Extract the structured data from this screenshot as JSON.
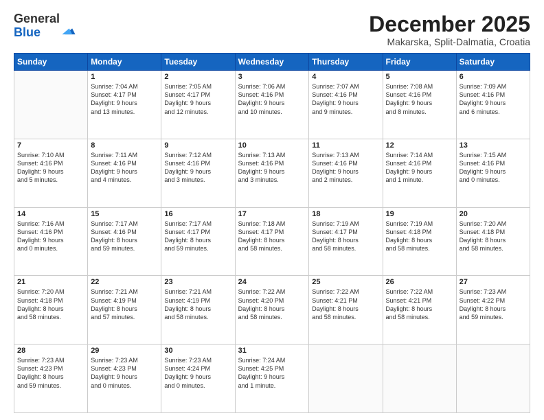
{
  "header": {
    "logo_general": "General",
    "logo_blue": "Blue",
    "month_title": "December 2025",
    "location": "Makarska, Split-Dalmatia, Croatia"
  },
  "days_of_week": [
    "Sunday",
    "Monday",
    "Tuesday",
    "Wednesday",
    "Thursday",
    "Friday",
    "Saturday"
  ],
  "weeks": [
    [
      {
        "day": "",
        "info": ""
      },
      {
        "day": "1",
        "info": "Sunrise: 7:04 AM\nSunset: 4:17 PM\nDaylight: 9 hours\nand 13 minutes."
      },
      {
        "day": "2",
        "info": "Sunrise: 7:05 AM\nSunset: 4:17 PM\nDaylight: 9 hours\nand 12 minutes."
      },
      {
        "day": "3",
        "info": "Sunrise: 7:06 AM\nSunset: 4:16 PM\nDaylight: 9 hours\nand 10 minutes."
      },
      {
        "day": "4",
        "info": "Sunrise: 7:07 AM\nSunset: 4:16 PM\nDaylight: 9 hours\nand 9 minutes."
      },
      {
        "day": "5",
        "info": "Sunrise: 7:08 AM\nSunset: 4:16 PM\nDaylight: 9 hours\nand 8 minutes."
      },
      {
        "day": "6",
        "info": "Sunrise: 7:09 AM\nSunset: 4:16 PM\nDaylight: 9 hours\nand 6 minutes."
      }
    ],
    [
      {
        "day": "7",
        "info": "Sunrise: 7:10 AM\nSunset: 4:16 PM\nDaylight: 9 hours\nand 5 minutes."
      },
      {
        "day": "8",
        "info": "Sunrise: 7:11 AM\nSunset: 4:16 PM\nDaylight: 9 hours\nand 4 minutes."
      },
      {
        "day": "9",
        "info": "Sunrise: 7:12 AM\nSunset: 4:16 PM\nDaylight: 9 hours\nand 3 minutes."
      },
      {
        "day": "10",
        "info": "Sunrise: 7:13 AM\nSunset: 4:16 PM\nDaylight: 9 hours\nand 3 minutes."
      },
      {
        "day": "11",
        "info": "Sunrise: 7:13 AM\nSunset: 4:16 PM\nDaylight: 9 hours\nand 2 minutes."
      },
      {
        "day": "12",
        "info": "Sunrise: 7:14 AM\nSunset: 4:16 PM\nDaylight: 9 hours\nand 1 minute."
      },
      {
        "day": "13",
        "info": "Sunrise: 7:15 AM\nSunset: 4:16 PM\nDaylight: 9 hours\nand 0 minutes."
      }
    ],
    [
      {
        "day": "14",
        "info": "Sunrise: 7:16 AM\nSunset: 4:16 PM\nDaylight: 9 hours\nand 0 minutes."
      },
      {
        "day": "15",
        "info": "Sunrise: 7:17 AM\nSunset: 4:16 PM\nDaylight: 8 hours\nand 59 minutes."
      },
      {
        "day": "16",
        "info": "Sunrise: 7:17 AM\nSunset: 4:17 PM\nDaylight: 8 hours\nand 59 minutes."
      },
      {
        "day": "17",
        "info": "Sunrise: 7:18 AM\nSunset: 4:17 PM\nDaylight: 8 hours\nand 58 minutes."
      },
      {
        "day": "18",
        "info": "Sunrise: 7:19 AM\nSunset: 4:17 PM\nDaylight: 8 hours\nand 58 minutes."
      },
      {
        "day": "19",
        "info": "Sunrise: 7:19 AM\nSunset: 4:18 PM\nDaylight: 8 hours\nand 58 minutes."
      },
      {
        "day": "20",
        "info": "Sunrise: 7:20 AM\nSunset: 4:18 PM\nDaylight: 8 hours\nand 58 minutes."
      }
    ],
    [
      {
        "day": "21",
        "info": "Sunrise: 7:20 AM\nSunset: 4:18 PM\nDaylight: 8 hours\nand 58 minutes."
      },
      {
        "day": "22",
        "info": "Sunrise: 7:21 AM\nSunset: 4:19 PM\nDaylight: 8 hours\nand 57 minutes."
      },
      {
        "day": "23",
        "info": "Sunrise: 7:21 AM\nSunset: 4:19 PM\nDaylight: 8 hours\nand 58 minutes."
      },
      {
        "day": "24",
        "info": "Sunrise: 7:22 AM\nSunset: 4:20 PM\nDaylight: 8 hours\nand 58 minutes."
      },
      {
        "day": "25",
        "info": "Sunrise: 7:22 AM\nSunset: 4:21 PM\nDaylight: 8 hours\nand 58 minutes."
      },
      {
        "day": "26",
        "info": "Sunrise: 7:22 AM\nSunset: 4:21 PM\nDaylight: 8 hours\nand 58 minutes."
      },
      {
        "day": "27",
        "info": "Sunrise: 7:23 AM\nSunset: 4:22 PM\nDaylight: 8 hours\nand 59 minutes."
      }
    ],
    [
      {
        "day": "28",
        "info": "Sunrise: 7:23 AM\nSunset: 4:23 PM\nDaylight: 8 hours\nand 59 minutes."
      },
      {
        "day": "29",
        "info": "Sunrise: 7:23 AM\nSunset: 4:23 PM\nDaylight: 9 hours\nand 0 minutes."
      },
      {
        "day": "30",
        "info": "Sunrise: 7:23 AM\nSunset: 4:24 PM\nDaylight: 9 hours\nand 0 minutes."
      },
      {
        "day": "31",
        "info": "Sunrise: 7:24 AM\nSunset: 4:25 PM\nDaylight: 9 hours\nand 1 minute."
      },
      {
        "day": "",
        "info": ""
      },
      {
        "day": "",
        "info": ""
      },
      {
        "day": "",
        "info": ""
      }
    ]
  ]
}
